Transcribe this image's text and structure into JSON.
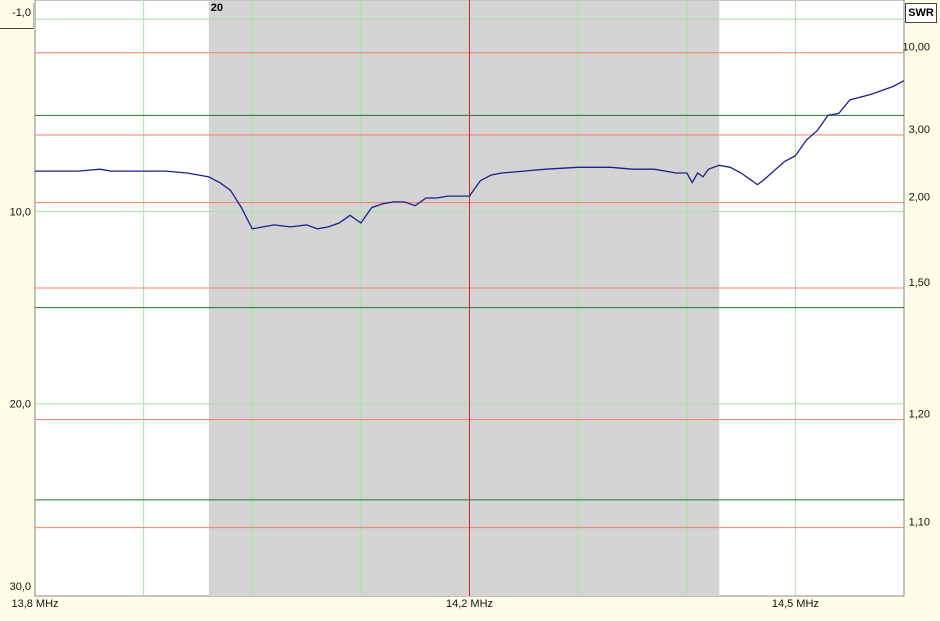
{
  "chart_data": {
    "type": "line",
    "x_axis": {
      "range_mhz": [
        13.8,
        14.6
      ],
      "tick_labels": [
        {
          "value": 13.8,
          "label": "13,8 MHz"
        },
        {
          "value": 14.2,
          "label": "14,2 MHz"
        },
        {
          "value": 14.5,
          "label": "14,5 MHz"
        }
      ],
      "vertical_gridlines_mhz": [
        13.9,
        14.0,
        14.1,
        14.2,
        14.3,
        14.4,
        14.5
      ]
    },
    "left_axis": {
      "range": [
        -1.0,
        30.0
      ],
      "tick_labels": [
        {
          "value": -1.0,
          "label": "-1,0"
        },
        {
          "value": 10.0,
          "label": "10,0"
        },
        {
          "value": 20.0,
          "label": "20,0"
        },
        {
          "value": 30.0,
          "label": "30,0"
        }
      ],
      "light_gridlines": [
        0,
        10,
        20
      ],
      "dark_gridlines": [
        5,
        15,
        25
      ]
    },
    "right_axis": {
      "title": "SWR",
      "scale": "swr (return-loss mapped)",
      "tick_labels": [
        {
          "value": 10.0,
          "label": "10,00"
        },
        {
          "value": 3.0,
          "label": "3,00"
        },
        {
          "value": 2.0,
          "label": "2,00"
        },
        {
          "value": 1.5,
          "label": "1,50"
        },
        {
          "value": 1.2,
          "label": "1,20"
        },
        {
          "value": 1.1,
          "label": "1,10"
        }
      ]
    },
    "band_highlight": {
      "label": "20",
      "from_mhz": 13.96,
      "to_mhz": 14.43,
      "color": "#d4d4d4"
    },
    "cursor_mhz": 14.2,
    "series": [
      {
        "color": "#1c1f8c",
        "x": [
          13.8,
          13.84,
          13.86,
          13.87,
          13.88,
          13.9,
          13.92,
          13.94,
          13.96,
          13.97,
          13.98,
          13.99,
          14.0,
          14.01,
          14.02,
          14.035,
          14.05,
          14.06,
          14.07,
          14.08,
          14.09,
          14.1,
          14.11,
          14.12,
          14.13,
          14.14,
          14.15,
          14.16,
          14.17,
          14.18,
          14.19,
          14.2,
          14.205,
          14.21,
          14.22,
          14.23,
          14.25,
          14.27,
          14.3,
          14.33,
          14.35,
          14.37,
          14.39,
          14.4,
          14.405,
          14.41,
          14.415,
          14.42,
          14.43,
          14.44,
          14.45,
          14.46,
          14.465,
          14.47,
          14.48,
          14.49,
          14.5,
          14.51,
          14.52,
          14.53,
          14.54,
          14.55,
          14.57,
          14.59,
          14.6
        ],
        "return_loss_db": [
          7.9,
          7.9,
          7.8,
          7.9,
          7.9,
          7.9,
          7.9,
          8.0,
          8.2,
          8.5,
          8.9,
          9.8,
          10.9,
          10.8,
          10.7,
          10.8,
          10.7,
          10.9,
          10.8,
          10.6,
          10.2,
          10.6,
          9.8,
          9.6,
          9.5,
          9.5,
          9.7,
          9.3,
          9.3,
          9.2,
          9.2,
          9.2,
          8.8,
          8.4,
          8.1,
          8.0,
          7.9,
          7.8,
          7.7,
          7.7,
          7.8,
          7.8,
          8.0,
          8.0,
          8.5,
          8.0,
          8.2,
          7.8,
          7.6,
          7.7,
          8.0,
          8.4,
          8.6,
          8.4,
          7.9,
          7.4,
          7.1,
          6.3,
          5.8,
          5.0,
          4.9,
          4.2,
          3.9,
          3.5,
          3.2
        ]
      }
    ]
  },
  "ui": {
    "swr_label": "SWR",
    "band_label": "20"
  }
}
